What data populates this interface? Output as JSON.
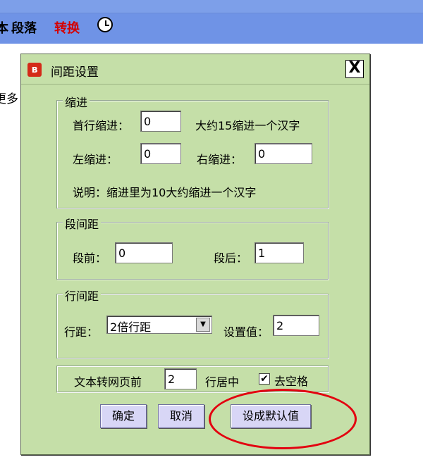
{
  "host": {
    "toolbar_items": [
      "本",
      "段落",
      "转换"
    ],
    "clock_icon": "clock-icon",
    "side_text": "更多"
  },
  "dialog": {
    "title": "间距设置",
    "close": "X",
    "indent": {
      "legend": "缩进",
      "first_line_label": "首行缩进：",
      "first_line_value": "0",
      "first_line_hint": "大约15缩进一个汉字",
      "left_label": "左缩进：",
      "left_value": "0",
      "right_label": "右缩进：",
      "right_value": "0",
      "note": "说明：缩进里为10大约缩进一个汉字"
    },
    "paragraph": {
      "legend": "段间距",
      "before_label": "段前：",
      "before_value": "0",
      "after_label": "段后：",
      "after_value": "1"
    },
    "line": {
      "legend": "行间距",
      "spacing_label": "行距：",
      "spacing_selected": "2倍行距",
      "value_label": "设置值：",
      "value": "2"
    },
    "web": {
      "prefix": "文本转网页前",
      "value": "2",
      "suffix": "行居中",
      "checkbox_checked": true,
      "checkbox_label": "去空格"
    },
    "buttons": {
      "ok": "确定",
      "cancel": "取消",
      "set_default": "设成默认值"
    }
  },
  "colors": {
    "dialog_bg": "#c5dfa8",
    "button_bg": "#d8d6f6",
    "highlight_circle": "#e3000f",
    "toolbar_bg": "#6f93e6"
  }
}
